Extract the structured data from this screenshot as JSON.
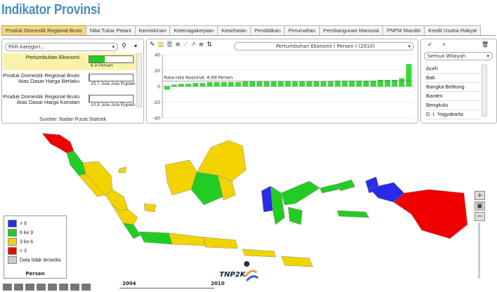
{
  "title": "Indikator Provinsi",
  "tabs": [
    "Produk Domestik Regional Bruto",
    "Nilai Tukar Petani",
    "Kemiskinan",
    "Ketenagakerjaan",
    "Kesehatan",
    "Pendidikan",
    "Perumahan",
    "Pembangunan Manusia",
    "PNPM Mandiri",
    "Kredit Usaha Rakyat"
  ],
  "active_tab": "Produk Domestik Regional Bruto",
  "left": {
    "category_placeholder": "Pilih kategori...",
    "indicators": [
      {
        "label": "Pertumbuhan Ekonomi",
        "value": "6.9 Persen",
        "fill": 0.35,
        "color": "#22cc22"
      },
      {
        "label": "Produk Domestik Regional Bruto Atas Dasar Harga Berlaku",
        "value": "25.7 Juta Juta Rupiah",
        "fill": 0.02,
        "color": "#888888"
      },
      {
        "label": "Produk Domestik Regional Bruto Atas Dasar Harga Konstan",
        "value": "10.9 Juta Juta Rupiah",
        "fill": 0.02,
        "color": "#888888"
      }
    ],
    "source": "Sumber: Badan Pusat Statistik"
  },
  "chart_title": "Pertumbuhan Ekonomi ( Persen ) (2010)",
  "chart_data": {
    "type": "bar",
    "title": "Pertumbuhan Ekonomi ( Persen ) (2010)",
    "ylim": [
      -40,
      40
    ],
    "yticks": [
      40,
      20,
      0,
      -20,
      -40
    ],
    "reference_label": "Rata-rata Nasional: 6.69 Persen",
    "reference_value": 6.69,
    "values": [
      -4,
      2,
      3,
      3,
      4,
      4,
      5,
      5,
      5,
      5,
      5,
      6,
      6,
      6,
      6,
      6,
      6,
      6,
      6,
      6,
      6,
      6,
      6,
      6,
      7,
      7,
      7,
      7,
      7,
      7,
      8,
      8,
      8,
      10,
      28
    ],
    "series_color": "#33dd33"
  },
  "right": {
    "filter": "Semua Wilayah",
    "regions": [
      "Aceh",
      "Bali",
      "Bangka Belitung",
      "Banten",
      "Bengkulu",
      "D. I. Yogyakarta"
    ]
  },
  "legend": {
    "title": "Persen",
    "items": [
      {
        "label": "> 9",
        "color": "#2a2ae8"
      },
      {
        "label": "6 ke 9",
        "color": "#22cc22"
      },
      {
        "label": "3 ke 6",
        "color": "#f2d300"
      },
      {
        "label": "< 3",
        "color": "#f00000"
      },
      {
        "label": "Data tidak tersedia",
        "color": "#cccccc"
      }
    ]
  },
  "timeline": {
    "start": "2004",
    "end": "2010"
  },
  "logo_text": "TNP2K",
  "icons": {
    "map_tools": [
      "globe-icon",
      "eye-icon",
      "download-icon",
      "share-icon",
      "settings-icon",
      "table-icon",
      "list-icon",
      "chart-icon"
    ]
  }
}
